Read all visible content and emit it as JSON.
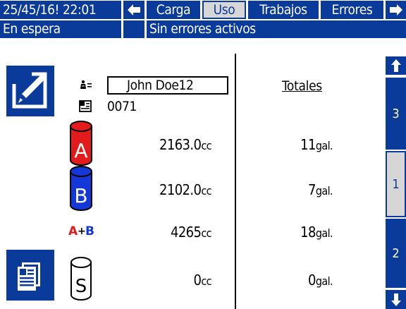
{
  "header": {
    "datetime": "25/45/16! 22:01",
    "tabs": [
      {
        "label": "Carga",
        "active": false
      },
      {
        "label": "Uso",
        "active": true
      },
      {
        "label": "Trabajos",
        "active": false
      },
      {
        "label": "Errores",
        "active": false
      }
    ]
  },
  "status": {
    "state": "En espera",
    "errors": "Sin errores activos"
  },
  "job": {
    "user_name": "John Doe12",
    "job_number": "0071"
  },
  "totals_title": "Totales",
  "rows": [
    {
      "icon": "A",
      "volume": "2163.0",
      "volume_unit": "cc",
      "total": "11",
      "total_unit": "gal."
    },
    {
      "icon": "B",
      "volume": "2102.0",
      "volume_unit": "cc",
      "total": "7",
      "total_unit": "gal."
    },
    {
      "icon": "A+B",
      "volume": "4265",
      "volume_unit": "cc",
      "total": "18",
      "total_unit": "gal."
    },
    {
      "icon": "S",
      "volume": "0",
      "volume_unit": "cc",
      "total": "0",
      "total_unit": "gal."
    }
  ],
  "side_tabs": [
    {
      "label": "3",
      "active": false
    },
    {
      "label": "1",
      "active": true
    },
    {
      "label": "2",
      "active": false
    }
  ],
  "colors": {
    "navy": "#0b3b9a",
    "component_a": "#e41b1b",
    "component_b": "#1437d8",
    "active_tab": "#d6d6d6"
  }
}
